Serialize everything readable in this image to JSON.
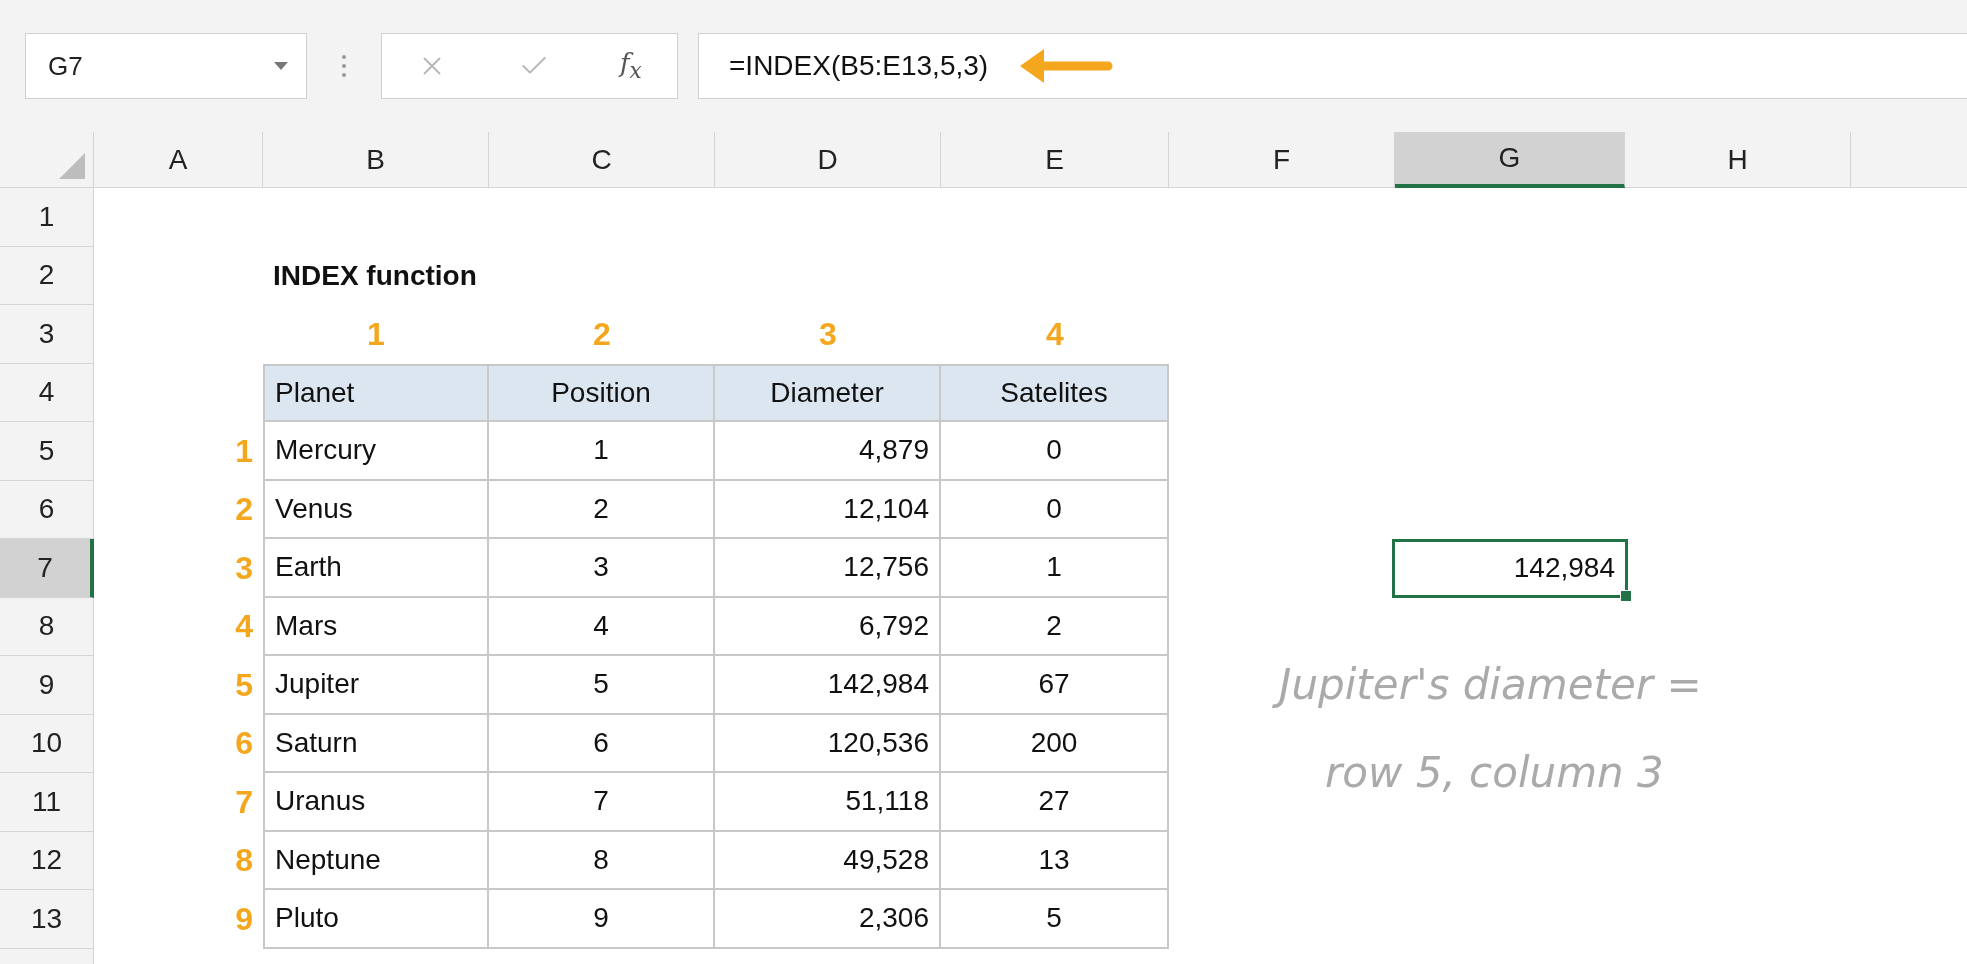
{
  "formula_bar": {
    "name_box": "G7",
    "fx_label": "f$_{x}$",
    "formula": "=INDEX(B5:E13,5,3)"
  },
  "column_headers": [
    {
      "label": "A",
      "selected": false
    },
    {
      "label": "B",
      "selected": false
    },
    {
      "label": "C",
      "selected": false
    },
    {
      "label": "D",
      "selected": false
    },
    {
      "label": "E",
      "selected": false
    },
    {
      "label": "F",
      "selected": false
    },
    {
      "label": "G",
      "selected": true
    },
    {
      "label": "H",
      "selected": false
    }
  ],
  "row_headers": [
    {
      "label": "1",
      "selected": false
    },
    {
      "label": "2",
      "selected": false
    },
    {
      "label": "3",
      "selected": false
    },
    {
      "label": "4",
      "selected": false
    },
    {
      "label": "5",
      "selected": false
    },
    {
      "label": "6",
      "selected": false
    },
    {
      "label": "7",
      "selected": true
    },
    {
      "label": "8",
      "selected": false
    },
    {
      "label": "9",
      "selected": false
    },
    {
      "label": "10",
      "selected": false
    },
    {
      "label": "11",
      "selected": false
    },
    {
      "label": "12",
      "selected": false
    },
    {
      "label": "13",
      "selected": false
    }
  ],
  "title": "INDEX function",
  "column_numbers": [
    "1",
    "2",
    "3",
    "4"
  ],
  "row_numbers": [
    "1",
    "2",
    "3",
    "4",
    "5",
    "6",
    "7",
    "8",
    "9"
  ],
  "table": {
    "columns": [
      "Planet",
      "Position",
      "Diameter",
      "Satelites"
    ],
    "rows": [
      [
        "Mercury",
        "1",
        "4,879",
        "0"
      ],
      [
        "Venus",
        "2",
        "12,104",
        "0"
      ],
      [
        "Earth",
        "3",
        "12,756",
        "1"
      ],
      [
        "Mars",
        "4",
        "6,792",
        "2"
      ],
      [
        "Jupiter",
        "5",
        "142,984",
        "67"
      ],
      [
        "Saturn",
        "6",
        "120,536",
        "200"
      ],
      [
        "Uranus",
        "7",
        "51,118",
        "27"
      ],
      [
        "Neptune",
        "8",
        "49,528",
        "13"
      ],
      [
        "Pluto",
        "9",
        "2,306",
        "5"
      ]
    ]
  },
  "result_cell": {
    "value": "142,984",
    "selected": true
  },
  "note": [
    "Jupiter's diameter =",
    "row 5, column 3"
  ]
}
